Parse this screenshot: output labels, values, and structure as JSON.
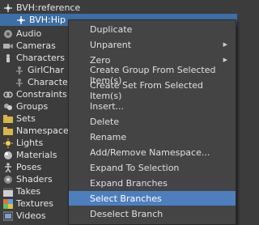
{
  "tree": {
    "items": [
      {
        "label": "BVH:reference",
        "icon": "joint-icon"
      },
      {
        "label": "BVH:Hip",
        "icon": "joint-icon"
      },
      {
        "label": "Audio",
        "icon": "audio-icon"
      },
      {
        "label": "Cameras",
        "icon": "camera-icon"
      },
      {
        "label": "Characters",
        "icon": "character-icon"
      },
      {
        "label": "GirlChar",
        "icon": "character-icon"
      },
      {
        "label": "Character",
        "icon": "character-icon"
      },
      {
        "label": "Constraints",
        "icon": "constraint-icon"
      },
      {
        "label": "Groups",
        "icon": "group-icon"
      },
      {
        "label": "Sets",
        "icon": "folder-icon"
      },
      {
        "label": "Namespaces",
        "icon": "folder-icon"
      },
      {
        "label": "Lights",
        "icon": "light-icon"
      },
      {
        "label": "Materials",
        "icon": "material-icon"
      },
      {
        "label": "Poses",
        "icon": "pose-icon"
      },
      {
        "label": "Shaders",
        "icon": "shader-icon"
      },
      {
        "label": "Takes",
        "icon": "take-icon"
      },
      {
        "label": "Textures",
        "icon": "texture-icon"
      },
      {
        "label": "Videos",
        "icon": "video-icon"
      }
    ]
  },
  "context_menu": {
    "items": [
      {
        "label": "Duplicate",
        "submenu": false
      },
      {
        "label": "Unparent",
        "submenu": true
      },
      {
        "label": "Zero",
        "submenu": true
      },
      {
        "label": "Create Group From Selected Item(s)",
        "submenu": false
      },
      {
        "label": "Create Set From Selected Item(s)",
        "submenu": false
      },
      {
        "label": "Insert...",
        "submenu": false
      },
      {
        "label": "Delete",
        "submenu": false
      },
      {
        "label": "Rename",
        "submenu": false
      },
      {
        "label": "Add/Remove Namespace...",
        "submenu": false
      },
      {
        "label": "Expand To Selection",
        "submenu": false
      },
      {
        "label": "Expand Branches",
        "submenu": false
      },
      {
        "label": "Select Branches",
        "submenu": false
      },
      {
        "label": "Deselect Branch",
        "submenu": false
      }
    ],
    "active_item": "Select Branches"
  },
  "colors": {
    "background": "#3c3c3c",
    "selection": "#3d6ea5",
    "menu_background": "#444444",
    "menu_highlight": "#4d7fbf"
  }
}
